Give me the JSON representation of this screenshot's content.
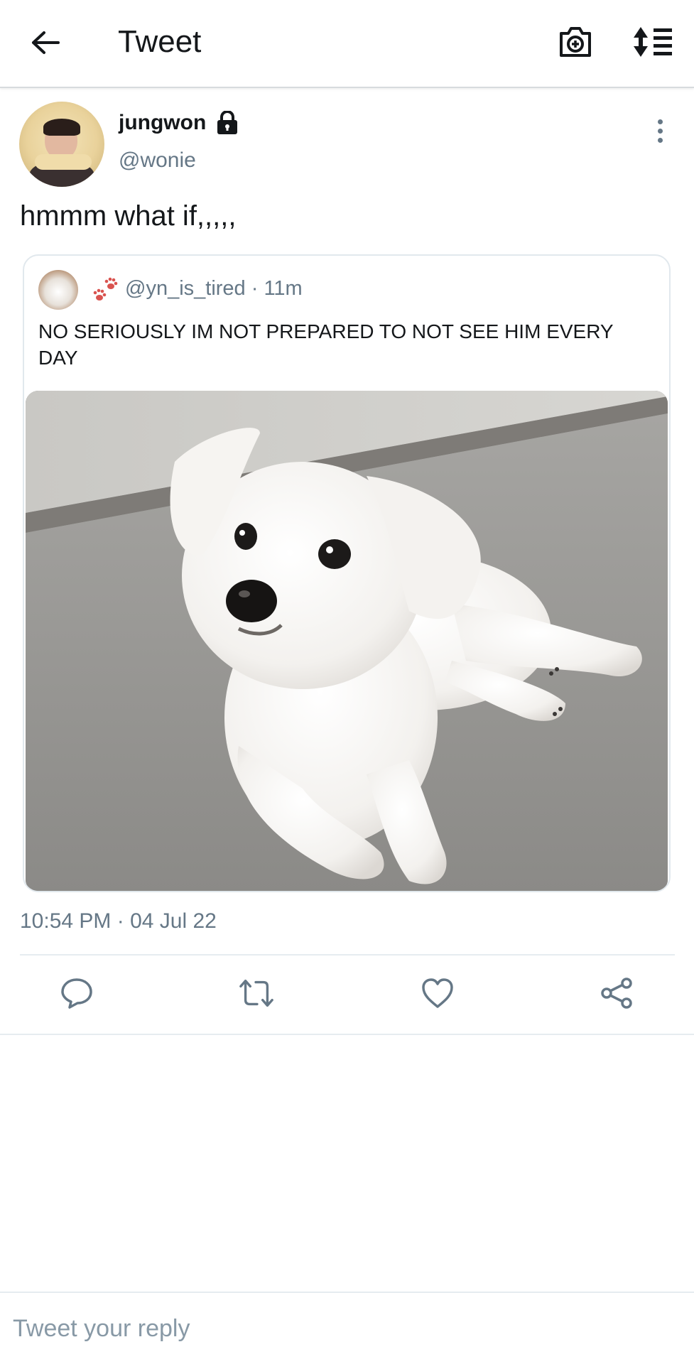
{
  "header": {
    "title": "Tweet",
    "back_icon": "arrow-left-icon",
    "camera_icon": "camera-plus-icon",
    "sort_icon": "sort-list-icon"
  },
  "tweet": {
    "author_name": "jungwon",
    "author_handle": "@wonie",
    "protected_icon": "lock-icon",
    "text": "hmmm what if,,,,,",
    "timestamp": "10:54 PM · 04 Jul 22"
  },
  "quoted_tweet": {
    "handle_meta": "@yn_is_tired · 11m",
    "text": "NO SERIOUSLY IM NOT PREPARED TO NOT SEE HIM EVERY DAY",
    "emoji_icon": "paw-prints-icon",
    "media_icon": "white-dog-photo"
  },
  "actions": {
    "reply_icon": "reply-icon",
    "retweet_icon": "retweet-icon",
    "like_icon": "heart-icon",
    "share_icon": "share-icon"
  },
  "reply": {
    "placeholder": "Tweet your reply"
  },
  "colors": {
    "text_primary": "#14171a",
    "text_secondary": "#657786",
    "border": "#e1e8ed",
    "paw": "#d9534f"
  }
}
